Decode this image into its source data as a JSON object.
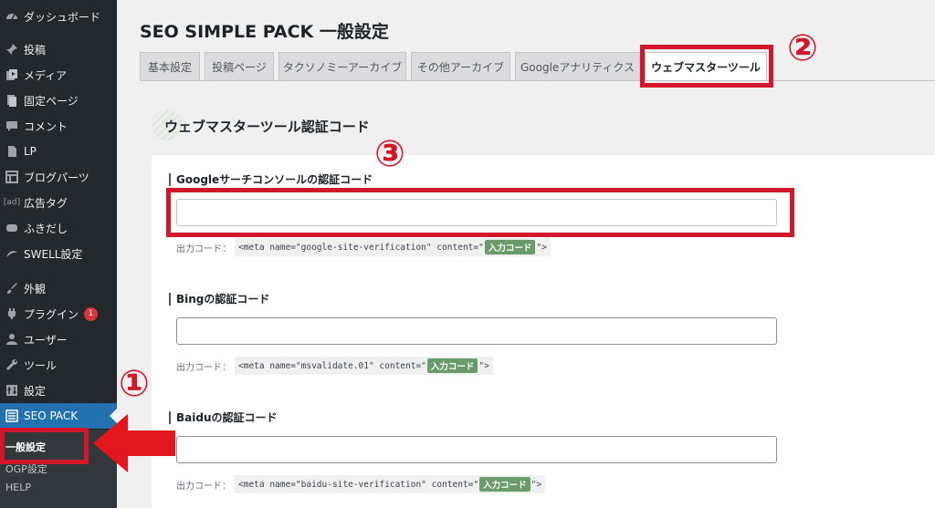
{
  "sidebar": {
    "items": [
      {
        "label": "ダッシュボード",
        "icon": "dashboard-icon"
      },
      {
        "label": "投稿",
        "icon": "pin-icon"
      },
      {
        "label": "メディア",
        "icon": "media-icon"
      },
      {
        "label": "固定ページ",
        "icon": "page-icon"
      },
      {
        "label": "コメント",
        "icon": "comment-icon"
      },
      {
        "label": "LP",
        "icon": "page-icon"
      },
      {
        "label": "ブログパーツ",
        "icon": "grid-icon"
      },
      {
        "label": "広告タグ",
        "icon": "ad-icon",
        "icon_text": "[ad]"
      },
      {
        "label": "ふきだし",
        "icon": "speech-bubble-icon"
      },
      {
        "label": "SWELL設定",
        "icon": "swell-icon"
      },
      {
        "label": "外観",
        "icon": "paintbrush-icon"
      },
      {
        "label": "プラグイン",
        "icon": "plugin-icon",
        "badge": "1"
      },
      {
        "label": "ユーザー",
        "icon": "user-icon"
      },
      {
        "label": "ツール",
        "icon": "wrench-icon"
      },
      {
        "label": "設定",
        "icon": "settings-icon"
      },
      {
        "label": "SEO PACK",
        "icon": "list-icon"
      }
    ],
    "submenu": [
      "一般設定",
      "OGP設定",
      "HELP"
    ]
  },
  "page": {
    "title": "SEO SIMPLE PACK 一般設定",
    "tabs": [
      "基本設定",
      "投稿ページ",
      "タクソノミーアーカイブ",
      "その他アーカイブ",
      "Googleアナリティクス",
      "ウェブマスターツール"
    ],
    "active_tab": "ウェブマスターツール",
    "section_title": "ウェブマスターツール認証コード"
  },
  "fields": [
    {
      "label": "Googleサーチコンソールの認証コード",
      "value": "",
      "output_label": "出力コード：",
      "code_before": "<meta name=\"google-site-verification\" content=\"",
      "code_tag": "入力コード",
      "code_after": "\">"
    },
    {
      "label": "Bingの認証コード",
      "value": "",
      "output_label": "出力コード：",
      "code_before": "<meta name=\"msvalidate.01\" content=\"",
      "code_tag": "入力コード",
      "code_after": "\">"
    },
    {
      "label": "Baiduの認証コード",
      "value": "",
      "output_label": "出力コード：",
      "code_before": "<meta name=\"baidu-site-verification\" content=\"",
      "code_tag": "入力コード",
      "code_after": "\">"
    }
  ],
  "annotations": {
    "numbers": [
      "①",
      "②",
      "③"
    ],
    "color": "#d3172a"
  },
  "colors": {
    "sidebar_bg": "#23282d",
    "sidebar_active": "#2271b1",
    "main_bg": "#f0f0f1",
    "code_tag": "#6a9c6a"
  }
}
